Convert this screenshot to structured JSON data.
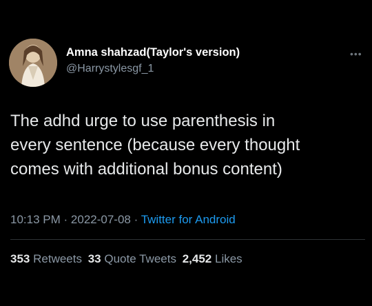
{
  "author": {
    "name": "Amna shahzad(Taylor's version)",
    "handle": "@Harrystylesgf_1"
  },
  "tweet": {
    "text_lines": [
      "The adhd urge to use parenthesis in",
      "every sentence (because every thought",
      "comes with additional bonus content)"
    ],
    "time": "10:13 PM",
    "date": "2022-07-08",
    "source": "Twitter for Android",
    "separator": "·"
  },
  "stats": {
    "retweets_count": "353",
    "retweets_label": "Retweets",
    "quotes_count": "33",
    "quotes_label": "Quote Tweets",
    "likes_count": "2,452",
    "likes_label": "Likes"
  },
  "icons": {
    "more": "more-horizontal-icon"
  },
  "colors": {
    "background": "#000000",
    "link": "#1d9bf0",
    "muted": "#8b98a5"
  }
}
